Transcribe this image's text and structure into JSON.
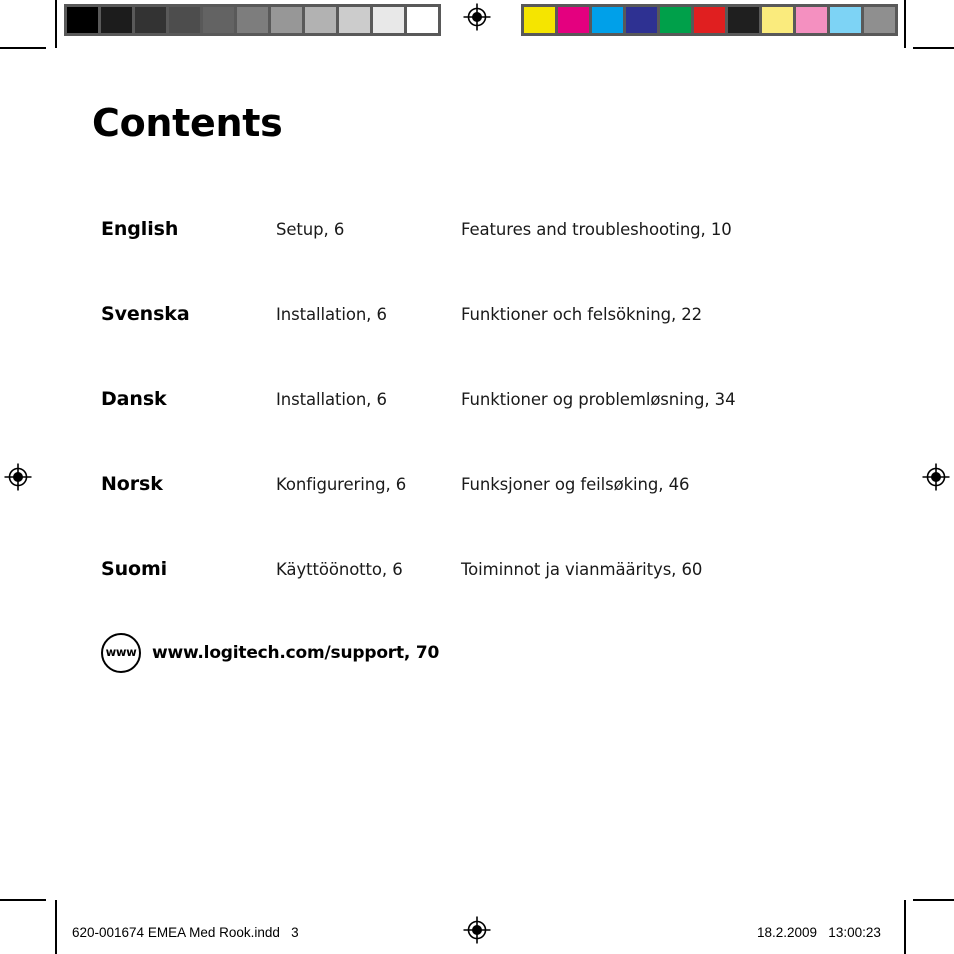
{
  "page": {
    "title": "Contents"
  },
  "colorbars": {
    "grayscale": {
      "name": "grayscale-calibration-bar",
      "swatches": [
        "#000000",
        "#1c1c1c",
        "#333333",
        "#4d4d4d",
        "#636363",
        "#7d7d7d",
        "#979797",
        "#b2b2b2",
        "#cccccc",
        "#e8e8e8",
        "#ffffff"
      ]
    },
    "process": {
      "name": "process-color-calibration-bar",
      "swatches": [
        "#f5e500",
        "#e4007f",
        "#00a0e9",
        "#2e3192",
        "#00a04a",
        "#e01f20",
        "#1f1f1f",
        "#faeb7d",
        "#f490c0",
        "#7dd3f5",
        "#8f8f8f"
      ]
    }
  },
  "toc": {
    "rows": [
      {
        "language": "English",
        "setup": "Setup, 6",
        "features": "Features and troubleshooting, 10"
      },
      {
        "language": "Svenska",
        "setup": "Installation, 6",
        "features": "Funktioner och felsökning, 22"
      },
      {
        "language": "Dansk",
        "setup": "Installation, 6",
        "features": "Funktioner og problemløsning, 34"
      },
      {
        "language": "Norsk",
        "setup": "Konfigurering, 6",
        "features": "Funksjoner og feilsøking, 46"
      },
      {
        "language": "Suomi",
        "setup": "Käyttöönotto, 6",
        "features": "Toiminnot ja vianmääritys, 60"
      }
    ]
  },
  "support": {
    "badge_label": "www",
    "text": "www.logitech.com/support, 70"
  },
  "footer": {
    "file_info": "620-001674 EMEA Med Rook.indd   3",
    "timestamp": "18.2.2009   13:00:23"
  }
}
